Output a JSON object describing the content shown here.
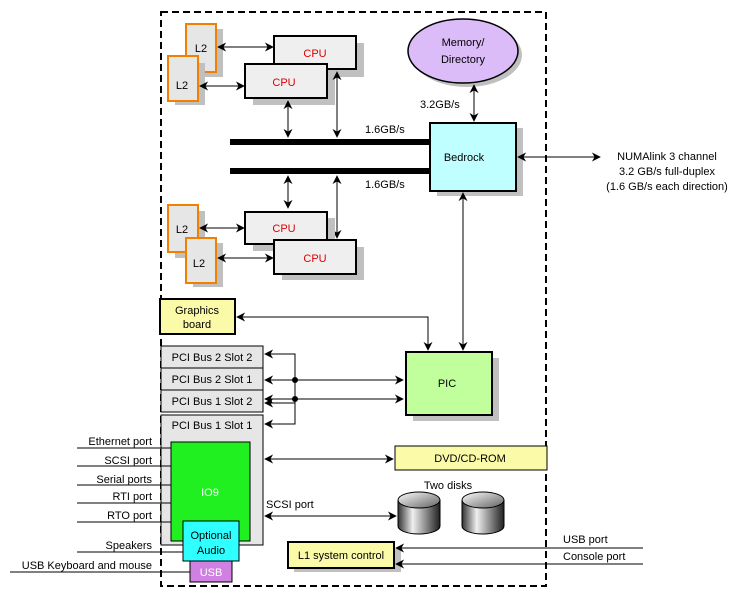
{
  "diagram": {
    "colors": {
      "l2_border": "#f08000",
      "box_fill": "#efefef",
      "shadow": "#c0c0c0",
      "cpu_text": "#e00000",
      "memory_fill": "#dcbcf8",
      "bedrock_fill": "#c0ffff",
      "pic_fill": "#c0ff9c",
      "graphics_fill": "#fafaa8",
      "io9_fill": "#20f020",
      "audio_fill": "#30ffff",
      "usb_fill": "#d080e0",
      "dvd_fill": "#fafaa8",
      "l1_fill": "#fafaa8"
    },
    "nodes": {
      "l2_top_1": "L2",
      "l2_top_2": "L2",
      "cpu_top_1": "CPU",
      "cpu_top_2": "CPU",
      "l2_bottom_1": "L2",
      "l2_bottom_2": "L2",
      "cpu_bottom_1": "CPU",
      "cpu_bottom_2": "CPU",
      "memory_line1": "Memory/",
      "memory_line2": "Directory",
      "bedrock": "Bedrock",
      "graphics_line1": "Graphics",
      "graphics_line2": "board",
      "pci_slots": [
        "PCI Bus 2 Slot 2",
        "PCI Bus 2 Slot 1",
        "PCI Bus 1 Slot 2",
        "PCI Bus 1 Slot 1"
      ],
      "pic": "PIC",
      "io9": "IO9",
      "audio_line1": "Optional",
      "audio_line2": "Audio",
      "usb": "USB",
      "dvd": "DVD/CD-ROM",
      "disks_label": "Two disks",
      "l1": "L1 system control"
    },
    "labels": {
      "memory_bandwidth": "3.2GB/s",
      "bus_top_bandwidth": "1.6GB/s",
      "bus_bottom_bandwidth": "1.6GB/s",
      "numalink_line1": "NUMAlink 3 channel",
      "numalink_line2": "3.2 GB/s full-duplex",
      "numalink_line3": "(1.6 GB/s each direction)",
      "scsi_internal": "SCSI port"
    },
    "external_ports_left": [
      "Ethernet port",
      "SCSI port",
      "Serial ports",
      "RTI port",
      "RTO port",
      "Speakers",
      "USB Keyboard and mouse"
    ],
    "external_ports_right": [
      "USB port",
      "Console port"
    ]
  }
}
